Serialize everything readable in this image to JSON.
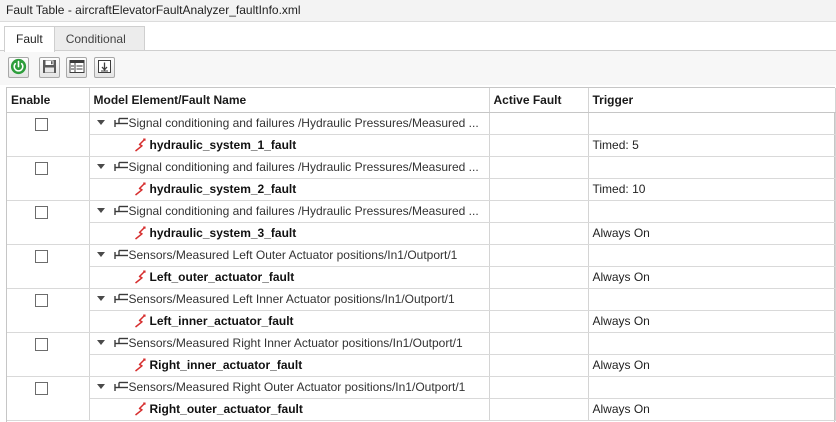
{
  "window": {
    "title": "Fault Table - aircraftElevatorFaultAnalyzer_faultInfo.xml"
  },
  "tabs": [
    {
      "label": "Fault",
      "active": true
    },
    {
      "label": "Conditional",
      "active": false
    }
  ],
  "toolbar": {
    "buttons": [
      {
        "icon": "power-icon",
        "color": "#2e9e3c"
      },
      {
        "icon": "save-icon"
      },
      {
        "icon": "table-view-icon"
      },
      {
        "icon": "import-icon"
      }
    ]
  },
  "table": {
    "headers": {
      "enable": "Enable",
      "name": "Model Element/Fault Name",
      "active": "Active Fault",
      "trigger": "Trigger"
    },
    "rows": [
      {
        "element": "Signal conditioning and failures /Hydraulic Pressures/Measured ...",
        "fault": "hydraulic_system_1_fault",
        "active": "",
        "trigger": "Timed: 5"
      },
      {
        "element": "Signal conditioning and failures /Hydraulic Pressures/Measured ...",
        "fault": "hydraulic_system_2_fault",
        "active": "",
        "trigger": "Timed: 10"
      },
      {
        "element": "Signal conditioning and failures /Hydraulic Pressures/Measured ...",
        "fault": "hydraulic_system_3_fault",
        "active": "",
        "trigger": "Always On"
      },
      {
        "element": "Sensors/Measured Left Outer Actuator positions/In1/Outport/1",
        "fault": "Left_outer_actuator_fault",
        "active": "",
        "trigger": "Always On"
      },
      {
        "element": "Sensors/Measured Left Inner Actuator positions/In1/Outport/1",
        "fault": "Left_inner_actuator_fault",
        "active": "",
        "trigger": "Always On"
      },
      {
        "element": "Sensors/Measured Right Inner Actuator positions/In1/Outport/1",
        "fault": "Right_inner_actuator_fault",
        "active": "",
        "trigger": "Always On"
      },
      {
        "element": "Sensors/Measured Right Outer Actuator positions/In1/Outport/1",
        "fault": "Right_outer_actuator_fault",
        "active": "",
        "trigger": "Always On"
      }
    ]
  },
  "colors": {
    "fault_icon": "#d62e2e",
    "power_green": "#2e9e3c"
  }
}
